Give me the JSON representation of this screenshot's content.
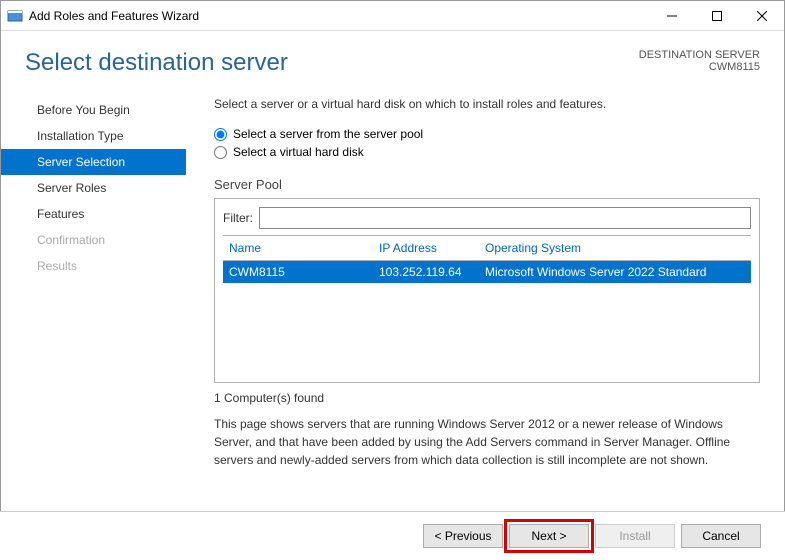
{
  "titlebar": {
    "title": "Add Roles and Features Wizard"
  },
  "header": {
    "page_title": "Select destination server",
    "right_label": "DESTINATION SERVER",
    "right_value": "CWM8115"
  },
  "sidebar": {
    "items": [
      {
        "label": "Before You Begin",
        "state": "normal"
      },
      {
        "label": "Installation Type",
        "state": "normal"
      },
      {
        "label": "Server Selection",
        "state": "active"
      },
      {
        "label": "Server Roles",
        "state": "normal"
      },
      {
        "label": "Features",
        "state": "normal"
      },
      {
        "label": "Confirmation",
        "state": "disabled"
      },
      {
        "label": "Results",
        "state": "disabled"
      }
    ]
  },
  "main": {
    "instruction": "Select a server or a virtual hard disk on which to install roles and features.",
    "radio1": "Select a server from the server pool",
    "radio2": "Select a virtual hard disk",
    "pool_label": "Server Pool",
    "filter_label": "Filter:",
    "filter_value": "",
    "columns": {
      "name": "Name",
      "ip": "IP Address",
      "os": "Operating System"
    },
    "rows": [
      {
        "name": "CWM8115",
        "ip": "103.252.119.64",
        "os": "Microsoft Windows Server 2022 Standard"
      }
    ],
    "found": "1 Computer(s) found",
    "note": "This page shows servers that are running Windows Server 2012 or a newer release of Windows Server, and that have been added by using the Add Servers command in Server Manager. Offline servers and newly-added servers from which data collection is still incomplete are not shown."
  },
  "footer": {
    "previous": "< Previous",
    "next": "Next >",
    "install": "Install",
    "cancel": "Cancel"
  }
}
